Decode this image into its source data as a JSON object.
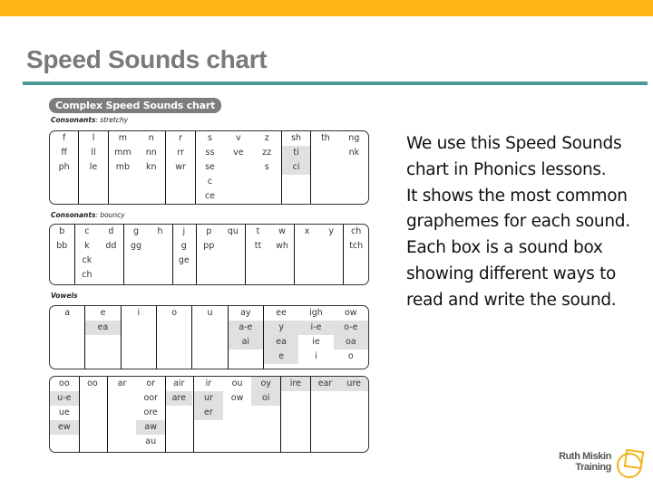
{
  "slide": {
    "title": "Speed Sounds chart",
    "description": [
      "We use this Speed Sounds chart in Phonics lessons.",
      "It shows the most common graphemes for each sound.",
      "Each box is a sound box showing different ways to read and write the sound."
    ],
    "colors": {
      "top_bar": "#fdb515",
      "title_rule": "#4a9a9a",
      "title_text": "#7a7a7a"
    }
  },
  "chart": {
    "title": "Complex Speed Sounds chart",
    "sections": [
      {
        "label_bold": "Consonants",
        "label_rest": ": stretchy",
        "groups": [
          [
            {
              "cells": [
                [
                  "f",
                  0
                ],
                [
                  "ff",
                  0
                ],
                [
                  "ph",
                  0
                ]
              ]
            }
          ],
          [
            {
              "cells": [
                [
                  "l",
                  0
                ],
                [
                  "ll",
                  0
                ],
                [
                  "le",
                  0
                ]
              ]
            }
          ],
          [
            {
              "cells": [
                [
                  "m",
                  0
                ],
                [
                  "mm",
                  0
                ],
                [
                  "mb",
                  0
                ]
              ]
            },
            {
              "cells": [
                [
                  "n",
                  0
                ],
                [
                  "nn",
                  0
                ],
                [
                  "kn",
                  0
                ]
              ]
            }
          ],
          [
            {
              "cells": [
                [
                  "r",
                  0
                ],
                [
                  "rr",
                  0
                ],
                [
                  "wr",
                  0
                ]
              ]
            }
          ],
          [
            {
              "cells": [
                [
                  "s",
                  0
                ],
                [
                  "ss",
                  0
                ],
                [
                  "se",
                  0
                ],
                [
                  "c",
                  0
                ],
                [
                  "ce",
                  0
                ]
              ]
            },
            {
              "cells": [
                [
                  "v",
                  0
                ],
                [
                  "ve",
                  0
                ]
              ]
            },
            {
              "cells": [
                [
                  "z",
                  0
                ],
                [
                  "zz",
                  0
                ],
                [
                  "s",
                  0
                ]
              ]
            }
          ],
          [
            {
              "cells": [
                [
                  "sh",
                  0
                ],
                [
                  "ti",
                  1
                ],
                [
                  "ci",
                  1
                ]
              ]
            }
          ],
          [
            {
              "cells": [
                [
                  "th",
                  0
                ]
              ]
            },
            {
              "cells": [
                [
                  "ng",
                  0
                ],
                [
                  "nk",
                  0
                ]
              ]
            }
          ]
        ]
      },
      {
        "label_bold": "Consonants",
        "label_rest": ": bouncy",
        "groups": [
          [
            {
              "cells": [
                [
                  "b",
                  0
                ],
                [
                  "bb",
                  0
                ]
              ]
            }
          ],
          [
            {
              "cells": [
                [
                  "c",
                  0
                ],
                [
                  "k",
                  0
                ],
                [
                  "ck",
                  0
                ],
                [
                  "ch",
                  0
                ]
              ]
            },
            {
              "cells": [
                [
                  "d",
                  0
                ],
                [
                  "dd",
                  0
                ]
              ]
            }
          ],
          [
            {
              "cells": [
                [
                  "g",
                  0
                ],
                [
                  "gg",
                  0
                ]
              ]
            },
            {
              "cells": [
                [
                  "h",
                  0
                ]
              ]
            }
          ],
          [
            {
              "cells": [
                [
                  "j",
                  0
                ],
                [
                  "g",
                  0
                ],
                [
                  "ge",
                  0
                ]
              ]
            }
          ],
          [
            {
              "cells": [
                [
                  "p",
                  0
                ],
                [
                  "pp",
                  0
                ]
              ]
            },
            {
              "cells": [
                [
                  "qu",
                  0
                ]
              ]
            }
          ],
          [
            {
              "cells": [
                [
                  "t",
                  0
                ],
                [
                  "tt",
                  0
                ]
              ]
            },
            {
              "cells": [
                [
                  "w",
                  0
                ],
                [
                  "wh",
                  0
                ]
              ]
            }
          ],
          [
            {
              "cells": [
                [
                  "x",
                  0
                ]
              ]
            },
            {
              "cells": [
                [
                  "y",
                  0
                ]
              ]
            }
          ],
          [
            {
              "cells": [
                [
                  "ch",
                  0
                ],
                [
                  "tch",
                  0
                ]
              ]
            }
          ]
        ]
      },
      {
        "label_bold": "Vowels",
        "label_rest": "",
        "groups": [
          [
            {
              "cells": [
                [
                  "a",
                  0
                ]
              ]
            }
          ],
          [
            {
              "cells": [
                [
                  "e",
                  0
                ],
                [
                  "ea",
                  1
                ]
              ]
            }
          ],
          [
            {
              "cells": [
                [
                  "i",
                  0
                ]
              ]
            }
          ],
          [
            {
              "cells": [
                [
                  "o",
                  0
                ]
              ]
            }
          ],
          [
            {
              "cells": [
                [
                  "u",
                  0
                ]
              ]
            }
          ],
          [
            {
              "cells": [
                [
                  "ay",
                  0
                ],
                [
                  "a-e",
                  1
                ],
                [
                  "ai",
                  1
                ]
              ]
            }
          ],
          [
            {
              "cells": [
                [
                  "ee",
                  0
                ],
                [
                  "y",
                  1
                ],
                [
                  "ea",
                  1
                ],
                [
                  "e",
                  1
                ]
              ]
            },
            {
              "cells": [
                [
                  "igh",
                  0
                ],
                [
                  "i-e",
                  1
                ],
                [
                  "ie",
                  0
                ],
                [
                  "i",
                  0
                ]
              ]
            },
            {
              "cells": [
                [
                  "ow",
                  0
                ],
                [
                  "o-e",
                  1
                ],
                [
                  "oa",
                  1
                ],
                [
                  "o",
                  0
                ]
              ]
            }
          ]
        ]
      },
      {
        "label_bold": "",
        "label_rest": "",
        "groups": [
          [
            {
              "cells": [
                [
                  "oo",
                  0
                ],
                [
                  "u-e",
                  1
                ],
                [
                  "ue",
                  0
                ],
                [
                  "ew",
                  1
                ]
              ]
            }
          ],
          [
            {
              "cells": [
                [
                  "oo",
                  0
                ]
              ]
            }
          ],
          [
            {
              "cells": [
                [
                  "ar",
                  0
                ]
              ]
            },
            {
              "cells": [
                [
                  "or",
                  0
                ],
                [
                  "oor",
                  0
                ],
                [
                  "ore",
                  0
                ],
                [
                  "aw",
                  1
                ],
                [
                  "au",
                  0
                ]
              ]
            }
          ],
          [
            {
              "cells": [
                [
                  "air",
                  0
                ],
                [
                  "are",
                  1
                ]
              ]
            }
          ],
          [
            {
              "cells": [
                [
                  "ir",
                  0
                ],
                [
                  "ur",
                  1
                ],
                [
                  "er",
                  1
                ]
              ]
            },
            {
              "cells": [
                [
                  "ou",
                  0
                ],
                [
                  "ow",
                  0
                ]
              ]
            },
            {
              "cells": [
                [
                  "oy",
                  1
                ],
                [
                  "oi",
                  1
                ]
              ]
            }
          ],
          [
            {
              "cells": [
                [
                  "ire",
                  1
                ]
              ]
            }
          ],
          [
            {
              "cells": [
                [
                  "ear",
                  1
                ]
              ]
            },
            {
              "cells": [
                [
                  "ure",
                  1
                ]
              ]
            }
          ]
        ]
      }
    ]
  },
  "logo": {
    "line1": "Ruth Miskin",
    "line2": "Training",
    "color": "#f2b51c"
  }
}
